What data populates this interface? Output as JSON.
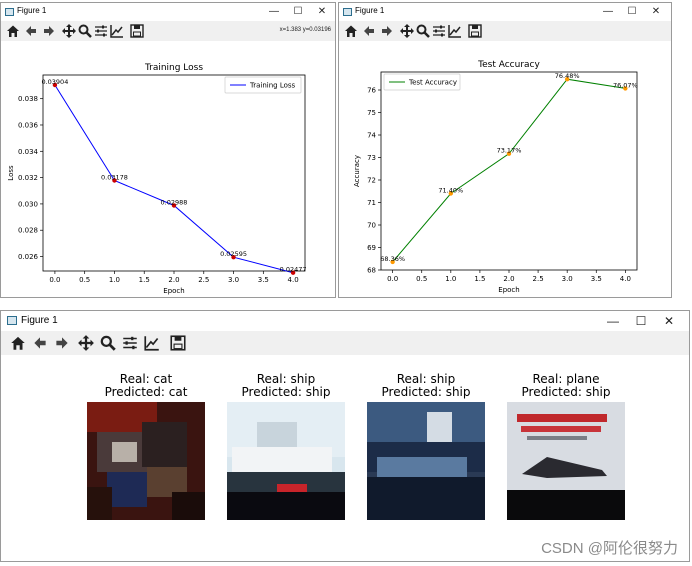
{
  "window_left": {
    "title": "Figure 1",
    "coords_text": "x=1.383  y=0.03196",
    "plot": {
      "title": "Training Loss",
      "xlabel": "Epoch",
      "ylabel": "Loss",
      "legend": "Training Loss",
      "x_ticks": [
        "0.0",
        "0.5",
        "1.0",
        "1.5",
        "2.0",
        "2.5",
        "3.0",
        "3.5",
        "4.0"
      ],
      "y_ticks": [
        "0.026",
        "0.028",
        "0.030",
        "0.032",
        "0.034",
        "0.036",
        "0.038"
      ],
      "point_labels": [
        "0.03904",
        "0.03178",
        "0.02988",
        "0.02595",
        "0.02477"
      ]
    }
  },
  "window_right": {
    "title": "Figure 1",
    "plot": {
      "title": "Test Accuracy",
      "xlabel": "Epoch",
      "ylabel": "Accuracy",
      "legend": "Test Accuracy",
      "x_ticks": [
        "0.0",
        "0.5",
        "1.0",
        "1.5",
        "2.0",
        "2.5",
        "3.0",
        "3.5",
        "4.0"
      ],
      "y_ticks": [
        "68",
        "69",
        "70",
        "71",
        "72",
        "73",
        "74",
        "75",
        "76"
      ],
      "point_labels": [
        "68.36%",
        "71.40%",
        "73.17%",
        "76.48%",
        "76.07%"
      ]
    }
  },
  "window_bottom": {
    "title": "Figure 1",
    "panels": [
      {
        "real": "Real: cat",
        "predicted": "Predicted: cat"
      },
      {
        "real": "Real: ship",
        "predicted": "Predicted: ship"
      },
      {
        "real": "Real: ship",
        "predicted": "Predicted: ship"
      },
      {
        "real": "Real: plane",
        "predicted": "Predicted: ship"
      }
    ]
  },
  "window_controls": {
    "minimize": "—",
    "maximize": "☐",
    "close": "✕"
  },
  "toolbar_icons": [
    "home-icon",
    "back-icon",
    "forward-icon",
    "pan-icon",
    "zoom-icon",
    "configure-subplots-icon",
    "edit-axis-icon",
    "save-icon"
  ],
  "watermark": "CSDN @阿伦很努力",
  "colors": {
    "loss_line": "#0000ff",
    "acc_line": "#008000",
    "loss_marker": "#cc0000",
    "acc_marker": "#ff9900",
    "toolbar_bg": "#f0f0f0"
  },
  "chart_data": [
    {
      "type": "line",
      "title": "Training Loss",
      "xlabel": "Epoch",
      "ylabel": "Loss",
      "x": [
        0,
        1,
        2,
        3,
        4
      ],
      "series": [
        {
          "name": "Training Loss",
          "values": [
            0.03904,
            0.03178,
            0.02988,
            0.02595,
            0.02477
          ]
        }
      ],
      "xlim": [
        -0.2,
        4.2
      ],
      "ylim": [
        0.0249,
        0.0398
      ],
      "legend": "top-right",
      "grid": false
    },
    {
      "type": "line",
      "title": "Test Accuracy",
      "xlabel": "Epoch",
      "ylabel": "Accuracy",
      "x": [
        0,
        1,
        2,
        3,
        4
      ],
      "series": [
        {
          "name": "Test Accuracy",
          "values": [
            68.36,
            71.4,
            73.17,
            76.48,
            76.07
          ]
        }
      ],
      "xlim": [
        -0.2,
        4.2
      ],
      "ylim": [
        68.0,
        76.8
      ],
      "legend": "top-left",
      "grid": false
    }
  ]
}
